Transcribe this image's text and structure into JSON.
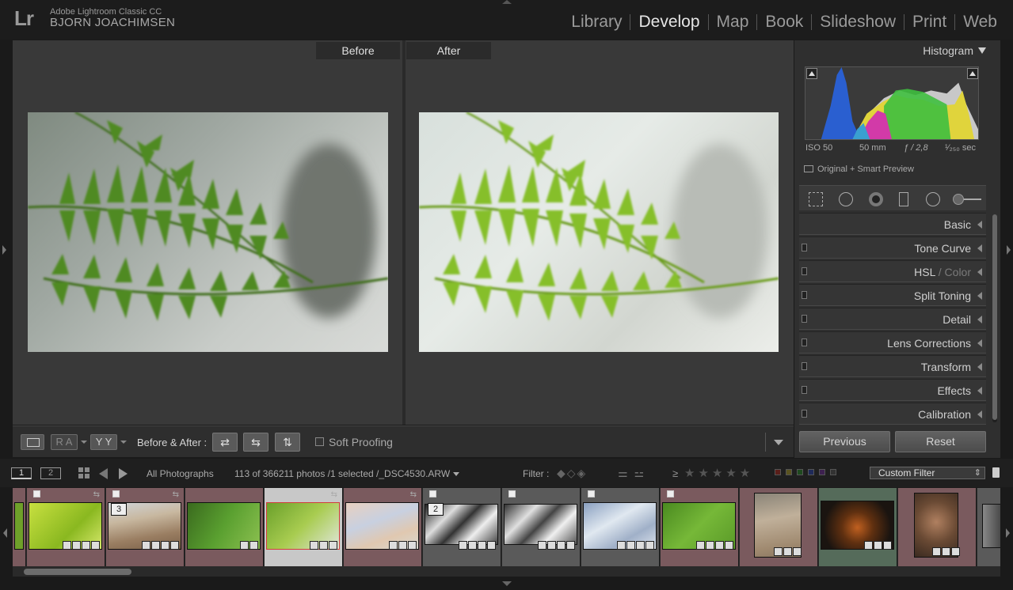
{
  "identity": {
    "logo": "Lr",
    "app_name": "Adobe Lightroom Classic CC",
    "user_name": "BJORN JOACHIMSEN"
  },
  "modules": [
    {
      "label": "Library",
      "active": false
    },
    {
      "label": "Develop",
      "active": true
    },
    {
      "label": "Map",
      "active": false
    },
    {
      "label": "Book",
      "active": false
    },
    {
      "label": "Slideshow",
      "active": false
    },
    {
      "label": "Print",
      "active": false
    },
    {
      "label": "Web",
      "active": false
    }
  ],
  "view": {
    "before_label": "Before",
    "after_label": "After"
  },
  "toolbar": {
    "ra_label": "R A",
    "yy_label": "Y Y",
    "before_after_label": "Before & After :",
    "soft_proofing_label": "Soft Proofing",
    "swap_1": "⇄",
    "swap_2": "⇆",
    "swap_3": "⇅"
  },
  "histogram": {
    "title": "Histogram",
    "iso": "ISO 50",
    "focal": "50 mm",
    "aperture": "ƒ / 2,8",
    "shutter": "¹⁄₂₅₀ sec",
    "preview": "Original + Smart Preview"
  },
  "panels": [
    {
      "label": "Basic",
      "dim": "",
      "has_switch": false
    },
    {
      "label": "Tone Curve",
      "dim": "",
      "has_switch": true
    },
    {
      "label": "HSL",
      "dim": " / Color",
      "has_switch": true
    },
    {
      "label": "Split Toning",
      "dim": "",
      "has_switch": true
    },
    {
      "label": "Detail",
      "dim": "",
      "has_switch": true
    },
    {
      "label": "Lens Corrections",
      "dim": "",
      "has_switch": true
    },
    {
      "label": "Transform",
      "dim": "",
      "has_switch": true
    },
    {
      "label": "Effects",
      "dim": "",
      "has_switch": true
    },
    {
      "label": "Calibration",
      "dim": "",
      "has_switch": true
    }
  ],
  "panel_buttons": {
    "previous": "Previous",
    "reset": "Reset"
  },
  "filmstrip_header": {
    "view1": "1",
    "view2": "2",
    "source": "All Photographs",
    "count": "113 of 366211 photos /1 selected /_DSC4530.ARW",
    "filter_label": "Filter :",
    "gte": "≥",
    "stars": "★★★★★",
    "custom_filter": "Custom Filter"
  },
  "filmstrip": {
    "badges": [
      "3",
      "2"
    ],
    "colors": {
      "pink_cell": "#7a5a5e",
      "grey_cell": "#5a5a5a",
      "green_cell": "#556b5a",
      "selected_cell": "#c8c8c8",
      "selected_border": "#d23c3c"
    }
  },
  "label_colors": [
    "#c0392b",
    "#d4c13a",
    "#3f8c3f",
    "#3a5ec0",
    "#8a4ab0",
    "#555555"
  ]
}
